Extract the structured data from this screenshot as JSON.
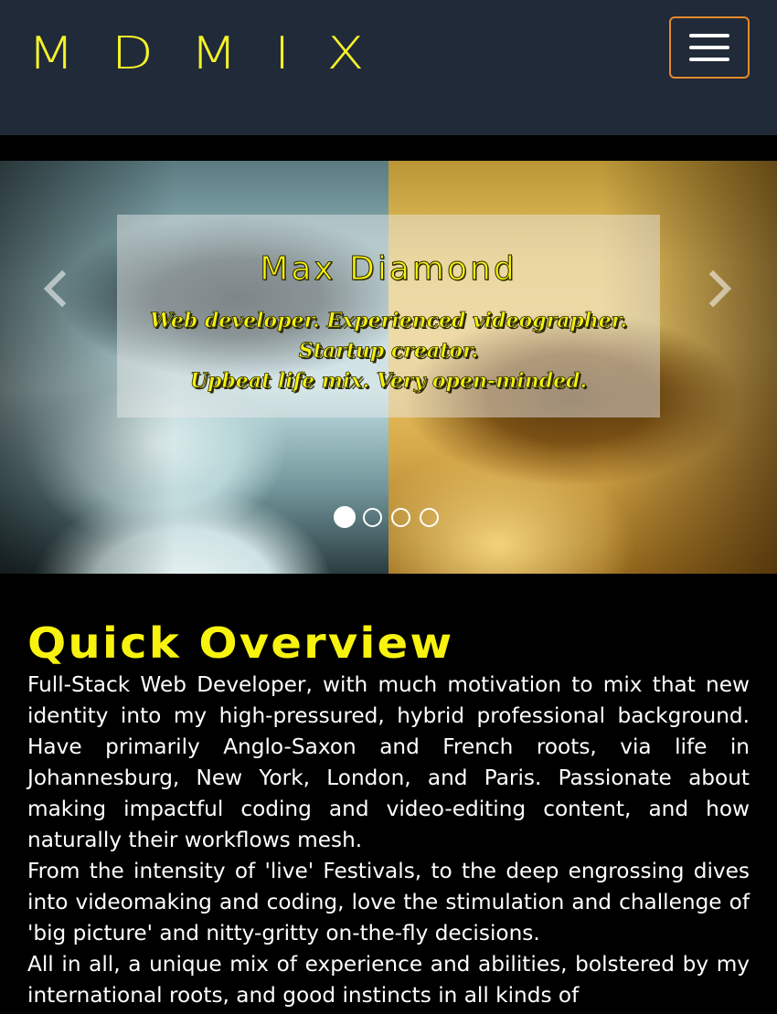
{
  "navbar": {
    "brand": "MDMIX",
    "menu_toggle_icon": "hamburger-icon",
    "toggle_border_color": "#e58a2c",
    "background_color": "#212a38"
  },
  "carousel": {
    "caption": {
      "title": "Max Diamond",
      "lines": [
        "Web developer. Experienced videographer.",
        "Startup creator.",
        "Upbeat life mix. Very open-minded."
      ]
    },
    "prev_icon": "chevron-left-icon",
    "next_icon": "chevron-right-icon",
    "slide_count": 4,
    "active_slide": 1
  },
  "overview": {
    "heading": "Quick Overview",
    "paragraphs": [
      "Full-Stack Web Developer, with much motivation to mix that new identity into my high-pressured, hybrid professional background. Have primarily Anglo-Saxon and French roots, via life in Johannesburg, New York, London, and Paris. Passionate about making impactful coding and video-editing content, and how naturally their workflows mesh.",
      "From the intensity of 'live' Festivals, to the deep engrossing dives into videomaking and coding, love the stimulation and challenge of 'big picture' and nitty-gritty on-the-fly decisions.",
      "All in all, a unique mix of experience and abilities, bolstered by my international roots, and good instincts in all kinds of"
    ]
  },
  "colors": {
    "accent_yellow": "#f7f30f",
    "page_background": "#000000"
  }
}
